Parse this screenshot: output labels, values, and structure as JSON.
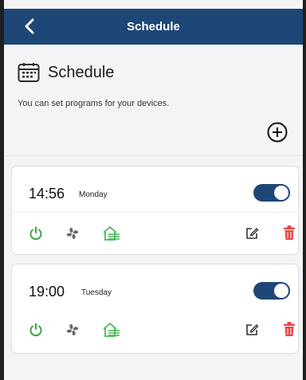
{
  "navbar": {
    "title": "Schedule",
    "back_icon": "chevron-left-icon"
  },
  "header": {
    "title": "Schedule",
    "subtitle": "You can set programs for your devices.",
    "icon": "calendar-icon",
    "add_icon": "plus-circle-icon"
  },
  "colors": {
    "navbar_bg": "#1e4676",
    "toggle_on": "#1e4676",
    "power_green": "#3aa546",
    "house_green": "#49b85b",
    "delete_red": "#e64646"
  },
  "schedules": [
    {
      "time": "14:56",
      "day": "Monday",
      "enabled": true,
      "icons": [
        "power-icon",
        "fan-icon",
        "house-heat-icon",
        "edit-icon",
        "trash-icon"
      ]
    },
    {
      "time": "19:00",
      "day": "Tuesday",
      "enabled": true,
      "icons": [
        "power-icon",
        "fan-icon",
        "house-heat-icon",
        "edit-icon",
        "trash-icon"
      ]
    }
  ]
}
